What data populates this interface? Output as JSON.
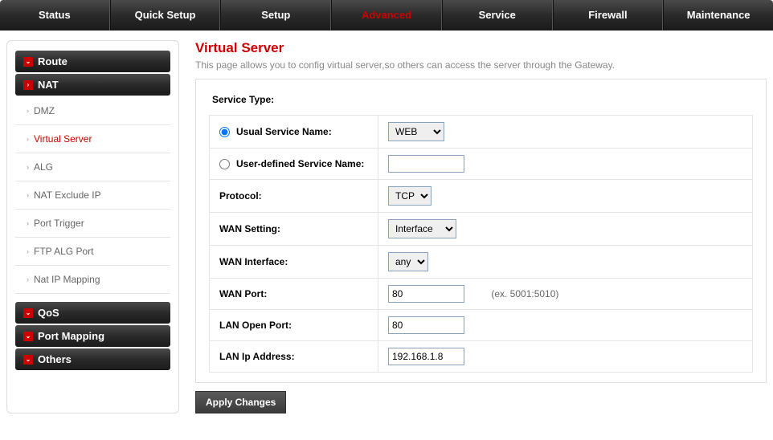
{
  "topnav": {
    "items": [
      "Status",
      "Quick Setup",
      "Setup",
      "Advanced",
      "Service",
      "Firewall",
      "Maintenance"
    ],
    "active_index": 3
  },
  "sidebar": {
    "categories": [
      {
        "label": "Route",
        "expanded": false
      },
      {
        "label": "NAT",
        "expanded": true,
        "items": [
          "DMZ",
          "Virtual Server",
          "ALG",
          "NAT Exclude IP",
          "Port Trigger",
          "FTP ALG Port",
          "Nat IP Mapping"
        ],
        "active_item": 1
      },
      {
        "label": "QoS",
        "expanded": false
      },
      {
        "label": "Port Mapping",
        "expanded": false
      },
      {
        "label": "Others",
        "expanded": false
      }
    ]
  },
  "page": {
    "title": "Virtual Server",
    "description": "This page allows you to config virtual server,so others can access the server through the Gateway."
  },
  "form": {
    "section_label": "Service Type:",
    "usual_service_label": "Usual Service Name:",
    "usual_service_value": "WEB",
    "user_defined_label": "User-defined Service Name:",
    "user_defined_value": "",
    "protocol_label": "Protocol:",
    "protocol_value": "TCP",
    "wan_setting_label": "WAN Setting:",
    "wan_setting_value": "Interface",
    "wan_interface_label": "WAN Interface:",
    "wan_interface_value": "any",
    "wan_port_label": "WAN Port:",
    "wan_port_value": "80",
    "wan_port_hint": "(ex. 5001:5010)",
    "lan_open_port_label": "LAN Open Port:",
    "lan_open_port_value": "80",
    "lan_ip_label": "LAN Ip Address:",
    "lan_ip_value": "192.168.1.8",
    "apply_button": "Apply Changes"
  }
}
